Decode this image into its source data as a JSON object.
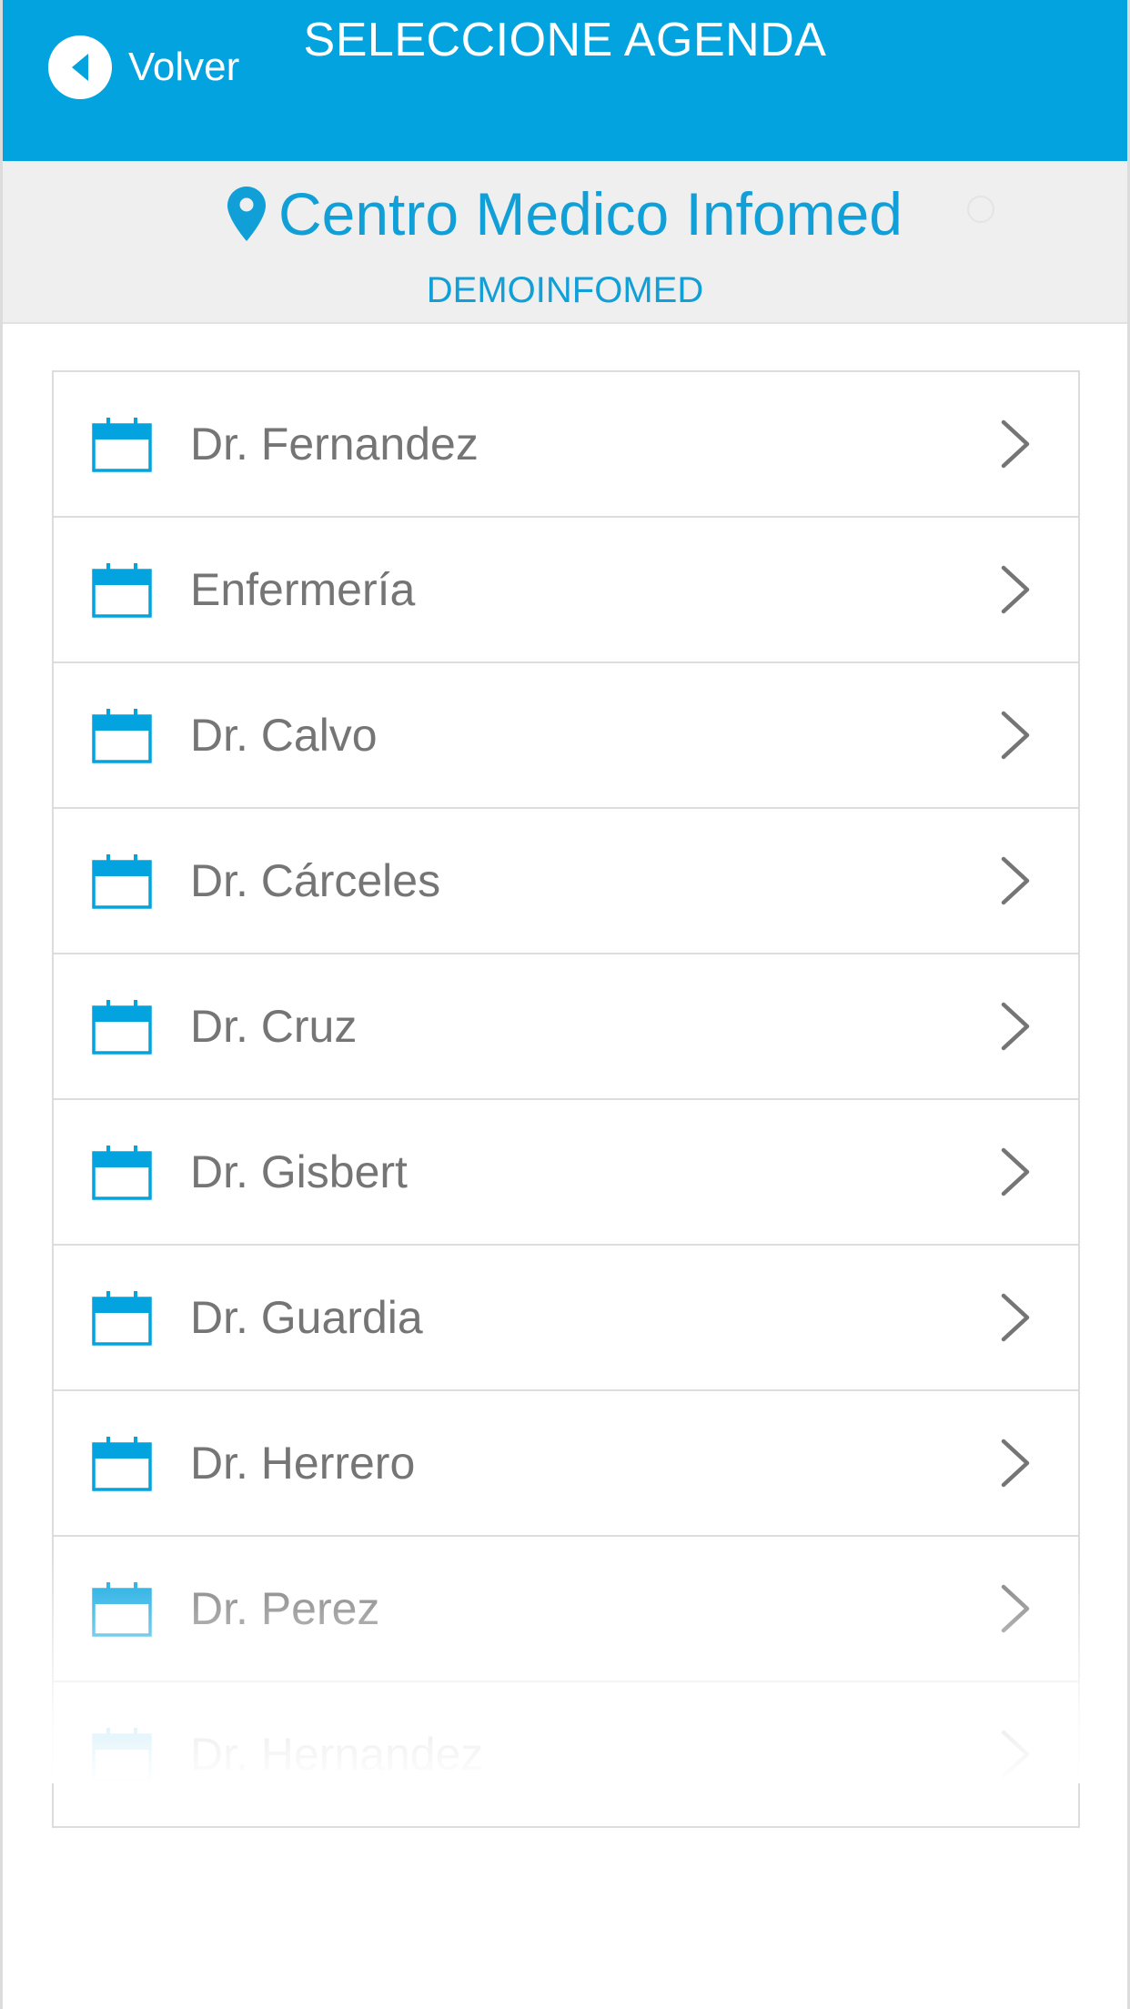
{
  "header": {
    "back_label": "Volver",
    "title": "SELECCIONE AGENDA"
  },
  "center": {
    "name": "Centro Medico Infomed",
    "code": "DEMOINFOMED",
    "pin_icon": "map-pin-icon"
  },
  "colors": {
    "brand_blue": "#03a3df",
    "accent_text": "#119fd8",
    "item_text": "#757575",
    "band_bg": "#efefef"
  },
  "agendas": [
    {
      "label": "Dr. Fernandez",
      "icon": "calendar-icon"
    },
    {
      "label": "Enfermería",
      "icon": "calendar-icon"
    },
    {
      "label": "Dr. Calvo",
      "icon": "calendar-icon"
    },
    {
      "label": "Dr. Cárceles",
      "icon": "calendar-icon"
    },
    {
      "label": "Dr. Cruz",
      "icon": "calendar-icon"
    },
    {
      "label": "Dr. Gisbert",
      "icon": "calendar-icon"
    },
    {
      "label": "Dr. Guardia",
      "icon": "calendar-icon"
    },
    {
      "label": "Dr. Herrero",
      "icon": "calendar-icon"
    },
    {
      "label": "Dr. Perez",
      "icon": "calendar-icon"
    },
    {
      "label": "Dr. Hernandez",
      "icon": "calendar-icon"
    }
  ]
}
